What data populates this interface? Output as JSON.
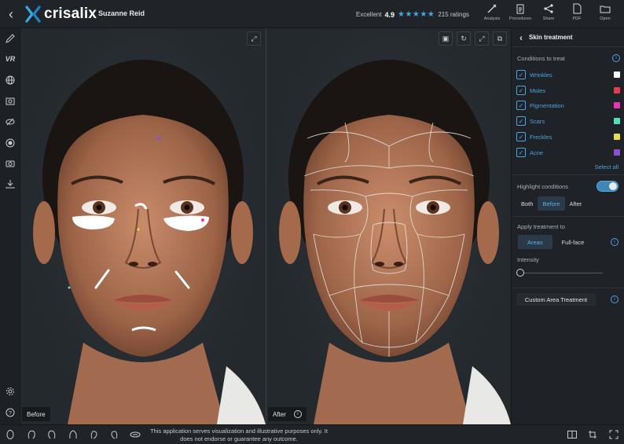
{
  "header": {
    "brand": "crisalix",
    "patient_name": "Suzanne Reid",
    "rating_label": "Excellent",
    "rating_value": "4.9",
    "stars": "★★★★★",
    "ratings_count": "215 ratings",
    "actions": [
      {
        "label": "Analysis",
        "icon": "ruler-pencil-icon"
      },
      {
        "label": "Procedures",
        "icon": "clipboard-icon"
      },
      {
        "label": "Share",
        "icon": "share-icon"
      },
      {
        "label": "PDF",
        "icon": "pdf-icon"
      },
      {
        "label": "Open",
        "icon": "folder-open-icon"
      }
    ]
  },
  "left_tools": {
    "vr_label": "VR",
    "items": [
      "pencil-icon",
      "vr-icon",
      "globe-icon",
      "camera-rotate-icon",
      "eye-slash-icon",
      "record-icon",
      "camera-icon",
      "download-icon"
    ],
    "bottom_items": [
      "settings-icon",
      "help-icon"
    ]
  },
  "viewport": {
    "before_label": "Before",
    "after_label": "After"
  },
  "panel": {
    "title": "Skin treatment",
    "conditions_title": "Conditions to treat",
    "conditions": [
      {
        "label": "Wrinkles",
        "checked": true,
        "color": "#ffffff"
      },
      {
        "label": "Moles",
        "checked": true,
        "color": "#e83a4d"
      },
      {
        "label": "Pigmentation",
        "checked": true,
        "color": "#e636b8"
      },
      {
        "label": "Scars",
        "checked": true,
        "color": "#4fe0c0"
      },
      {
        "label": "Freckles",
        "checked": true,
        "color": "#e9dd4e"
      },
      {
        "label": "Acne",
        "checked": true,
        "color": "#8b4fd6"
      }
    ],
    "select_all": "Select all",
    "highlight_label": "Highlight conditions",
    "highlight_on": true,
    "view_options": [
      "Both",
      "Before",
      "After"
    ],
    "view_selected": "Before",
    "apply_title": "Apply treatment to",
    "apply_options": [
      "Areas",
      "Full-face"
    ],
    "apply_selected": "Areas",
    "intensity_label": "Intensity",
    "intensity_value": 0,
    "custom_area_label": "Custom Area Treatment"
  },
  "footer": {
    "disclaimer": "This application serves visualization and illustrative purposes only. It does not endorse or guarantee any outcome.",
    "face_tools": [
      "face-front-icon",
      "face-left-icon",
      "face-right-icon",
      "face-half-icon",
      "face-profile-left-icon",
      "face-profile-right-icon",
      "face-top-icon"
    ],
    "right_tools": [
      "split-view-icon",
      "crop-icon",
      "fullscreen-icon"
    ]
  },
  "colors": {
    "accent": "#4aa3df",
    "background": "#1b1f23"
  }
}
